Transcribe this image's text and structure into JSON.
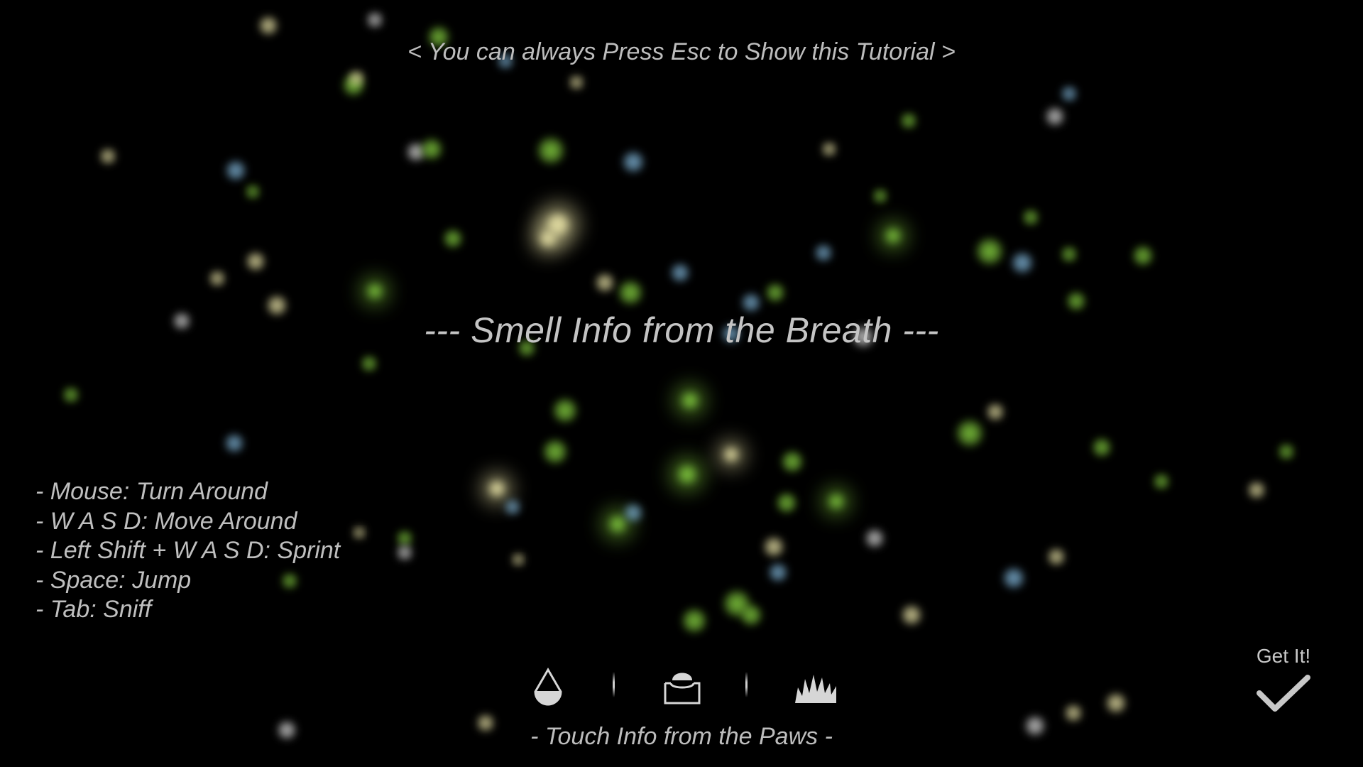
{
  "tutorial": {
    "top_hint": "< You can always Press Esc to Show this Tutorial >",
    "headline": "--- Smell Info from the Breath ---",
    "controls": [
      "Mouse: Turn Around",
      "W A S D: Move Around",
      "Left Shift + W A S D: Sprint",
      "Space: Jump",
      "Tab: Sniff"
    ],
    "paws_caption": "- Touch Info from the Paws -",
    "confirm_label": "Get It!"
  },
  "icons": {
    "left": "water-drop-icon",
    "middle": "mud-basin-icon",
    "right": "grass-icon",
    "confirm": "checkmark-icon"
  },
  "colors": {
    "background": "#000000",
    "text": "#c4c4c4",
    "particle_green": "#7fc63c",
    "particle_yellow": "#e8e2a6",
    "particle_blue": "#7fb3d6",
    "particle_white": "#d8d8d8"
  }
}
